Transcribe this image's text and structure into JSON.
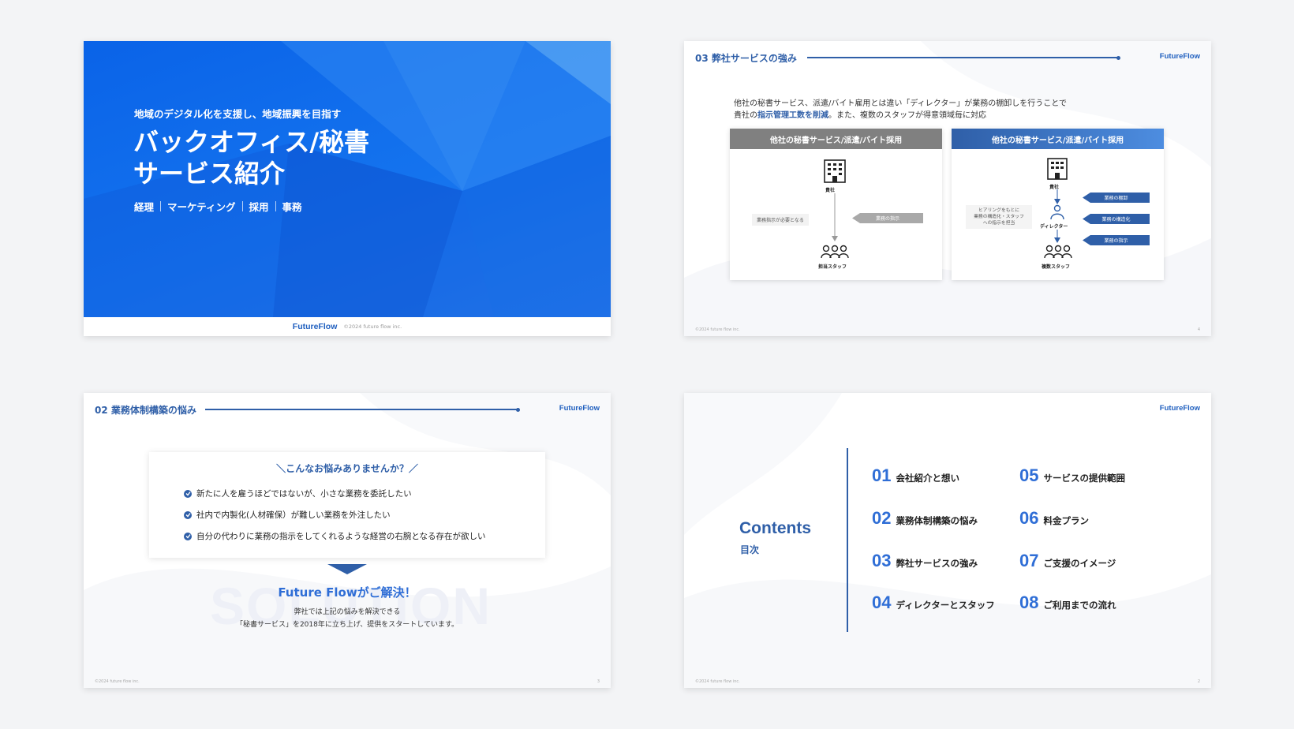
{
  "cover": {
    "subtitle": "地域のデジタル化を支援し、地域振興を目指す",
    "title_line1": "バックオフィス/秘書",
    "title_line2": "サービス紹介",
    "tags": [
      "経理",
      "マーケティング",
      "採用",
      "事務"
    ],
    "brand": "FutureFlow",
    "copyright": "©2024 future flow inc."
  },
  "strengths": {
    "section_title": "03 弊社サービスの強み",
    "brand": "FutureFlow",
    "intro_line1": "他社の秘書サービス、派遣/バイト雇用とは違い「ディレクター」が業務の棚卸しを行うことで",
    "intro_line2_prefix": "貴社の",
    "intro_line2_bold": "指示管理工数を削減",
    "intro_line2_suffix": "。また、複数のスタッフが得意領域毎に対応",
    "left": {
      "header": "他社の秘書サービス/派遣/バイト採用",
      "client_label": "貴社",
      "note": "業務指示が必要となる",
      "instruction": "業務の指示",
      "staff_label": "担当スタッフ"
    },
    "right": {
      "header": "他社の秘書サービス/派遣/バイト採用",
      "client_label": "貴社",
      "note_line1": "ヒアリングをもとに",
      "note_line2": "業務の構造化・スタッフ",
      "note_line3": "への指示を担当",
      "director_label": "ディレクター",
      "staff_label": "複数スタッフ",
      "tags": [
        "業務の棚卸",
        "業務の構造化",
        "業務の指示"
      ]
    },
    "copyright": "©2024 future flow inc.",
    "page": "4"
  },
  "problems": {
    "section_title": "02 業務体制構築の悩み",
    "brand": "FutureFlow",
    "card_title": "＼こんなお悩みありませんか？／",
    "items": [
      "新たに人を雇うほどではないが、小さな業務を委託したい",
      "社内で内製化(人材確保）が難しい業務を外注したい",
      "自分の代わりに業務の指示をしてくれるような経営の右腕となる存在が欲しい"
    ],
    "solution_bg": "SOLUTION",
    "solution_title": "Future Flowがご解決！",
    "solution_line1": "弊社では上記の悩みを解決できる",
    "solution_line2": "「秘書サービス」を2018年に立ち上げ、提供をスタートしています。",
    "copyright": "©2024 future flow inc.",
    "page": "3"
  },
  "contents": {
    "brand": "FutureFlow",
    "title_en": "Contents",
    "title_ja": "目次",
    "items": [
      {
        "num": "01",
        "label": "会社紹介と想い"
      },
      {
        "num": "02",
        "label": "業務体制構築の悩み"
      },
      {
        "num": "03",
        "label": "弊社サービスの強み"
      },
      {
        "num": "04",
        "label": "ディレクターとスタッフ"
      },
      {
        "num": "05",
        "label": "サービスの提供範囲"
      },
      {
        "num": "06",
        "label": "料金プラン"
      },
      {
        "num": "07",
        "label": "ご支援のイメージ"
      },
      {
        "num": "08",
        "label": "ご利用までの流れ"
      }
    ],
    "copyright": "©2024 future flow inc.",
    "page": "2"
  },
  "colors": {
    "accent": "#2f5fa8",
    "cover_blue": "#0a63e8",
    "grey_header": "#808080"
  }
}
